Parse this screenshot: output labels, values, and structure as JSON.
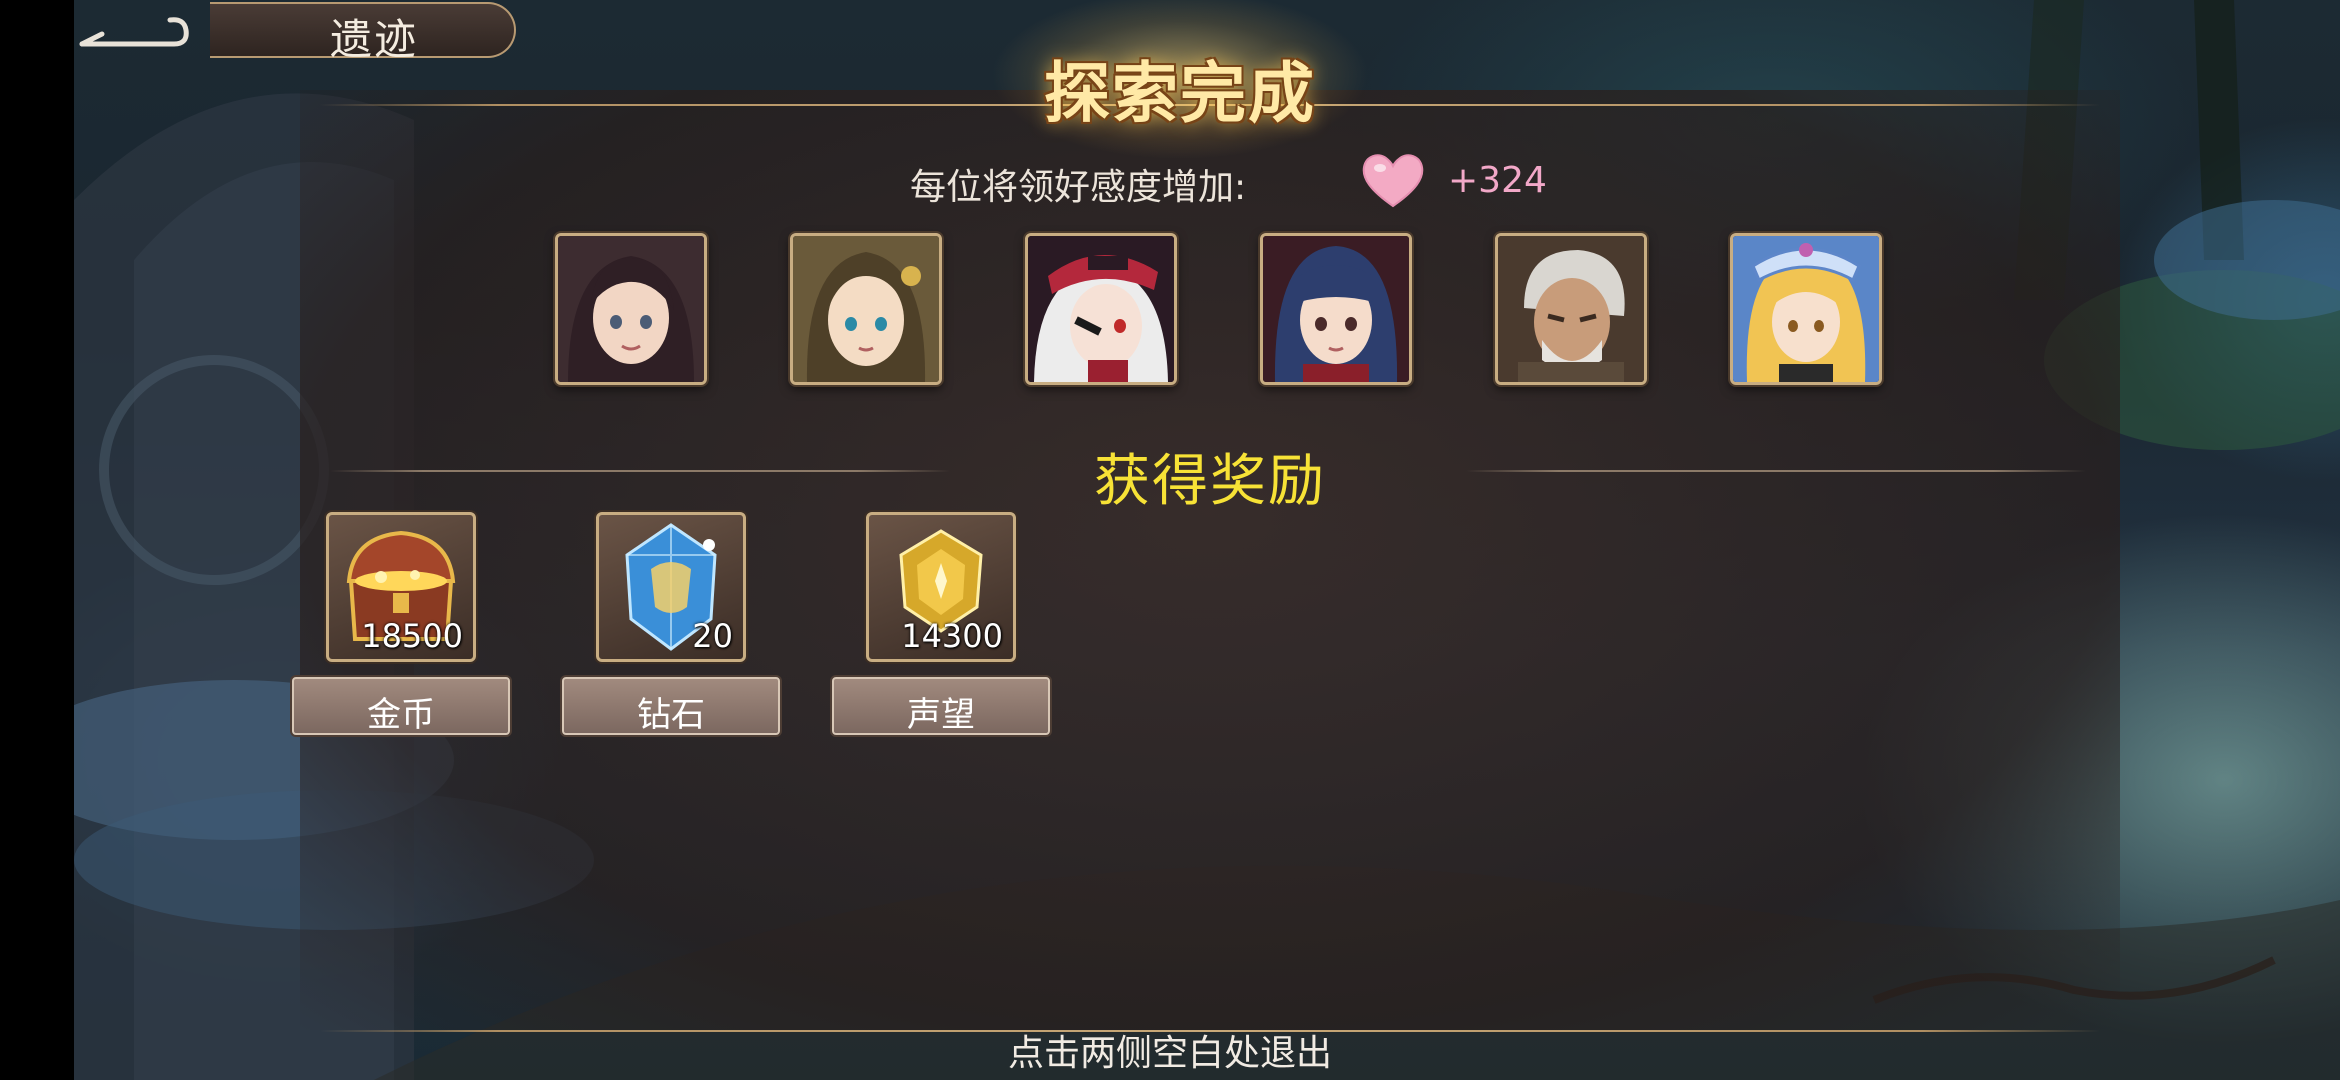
{
  "header": {
    "back_icon": "back-arrow-icon",
    "title": "遗迹"
  },
  "banner": {
    "text": "探索完成"
  },
  "favor": {
    "label": "每位将领好感度增加:",
    "icon": "heart-icon",
    "value": "+324"
  },
  "portraits": [
    {
      "name": "hero-1",
      "hair": "#3a2a30",
      "skin": "#f3d9c6",
      "accent": "#6b4a55"
    },
    {
      "name": "hero-2",
      "hair": "#5a4a2e",
      "skin": "#f4dcc4",
      "accent": "#c9a24a"
    },
    {
      "name": "hero-3",
      "hair": "#eeeeee",
      "skin": "#f6e1d6",
      "accent": "#b4283c"
    },
    {
      "name": "hero-4",
      "hair": "#2d3e6e",
      "skin": "#f5dccb",
      "accent": "#8a1f2a"
    },
    {
      "name": "hero-5",
      "hair": "#d9d6d0",
      "skin": "#c89c7a",
      "accent": "#5a4a3a"
    },
    {
      "name": "hero-6",
      "hair": "#f1c453",
      "skin": "#f7e0cd",
      "accent": "#5d86c9"
    }
  ],
  "rewards": {
    "title": "获得奖励",
    "items": [
      {
        "name": "金币",
        "qty": "18500",
        "icon": "treasure-chest-icon"
      },
      {
        "name": "钻石",
        "qty": "20",
        "icon": "diamond-crystal-icon"
      },
      {
        "name": "声望",
        "qty": "14300",
        "icon": "prestige-medal-icon"
      }
    ]
  },
  "footer": {
    "exit_hint": "点击两侧空白处退出"
  },
  "colors": {
    "rewards_title": "#f7e236",
    "favor_value": "#f2a8c8",
    "frame_gold": "#c8ad82"
  }
}
